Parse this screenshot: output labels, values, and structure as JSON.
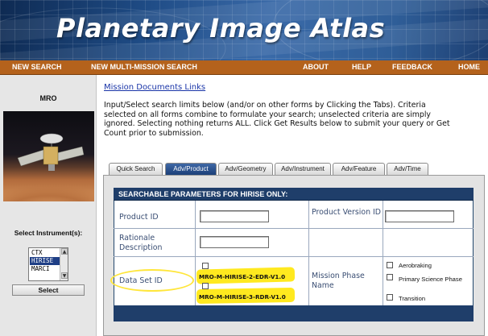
{
  "banner": {
    "title": "Planetary Image Atlas"
  },
  "nav": {
    "items": [
      {
        "label": "NEW SEARCH"
      },
      {
        "label": "NEW MULTI-MISSION SEARCH"
      },
      {
        "label": "ABOUT"
      },
      {
        "label": "HELP"
      },
      {
        "label": "FEEDBACK"
      },
      {
        "label": "HOME"
      }
    ]
  },
  "sidebar": {
    "mission": "MRO",
    "select_label": "Select Instrument(s):",
    "instruments": [
      "CTX",
      "HIRISE",
      "MARCI"
    ],
    "selected_instrument": "HIRISE",
    "select_button": "Select"
  },
  "main": {
    "link": "Mission Documents Links",
    "instructions": "Input/Select search limits below (and/or on other forms by Clicking the Tabs). Criteria selected on all forms combine to formulate your search; unselected criteria are simply ignored. Selecting nothing returns ALL. Click Get Results below to submit your query or Get Count prior to submission."
  },
  "tabs": [
    {
      "label": "Quick Search",
      "active": false
    },
    {
      "label": "Adv/Product",
      "active": true
    },
    {
      "label": "Adv/Geometry",
      "active": false
    },
    {
      "label": "Adv/Instrument",
      "active": false
    },
    {
      "label": "Adv/Feature",
      "active": false
    },
    {
      "label": "Adv/Time",
      "active": false
    }
  ],
  "panel": {
    "header": "SEARCHABLE PARAMETERS FOR HIRISE ONLY:",
    "product_id": {
      "label": "Product ID",
      "value": ""
    },
    "product_version_id": {
      "label": "Product Version ID",
      "value": ""
    },
    "rationale_description": {
      "label": "Rationale Description",
      "value": ""
    },
    "data_set_id": {
      "label": "Data Set ID",
      "options": [
        {
          "label": "MRO-M-HIRISE-2-EDR-V1.0",
          "checked": false
        },
        {
          "label": "MRO-M-HIRISE-3-RDR-V1.0",
          "checked": false
        }
      ]
    },
    "mission_phase_name": {
      "label": "Mission Phase Name",
      "options": [
        {
          "label": "Aerobraking",
          "checked": false
        },
        {
          "label": "Primary Science Phase",
          "checked": false
        },
        {
          "label": "Transition",
          "checked": false
        }
      ]
    }
  },
  "colors": {
    "nav_bg": "#b4621c",
    "header_bg": "#1f3e6a",
    "active_tab": "#2c5390",
    "link": "#1a35a8",
    "highlight": "#ffe600"
  }
}
